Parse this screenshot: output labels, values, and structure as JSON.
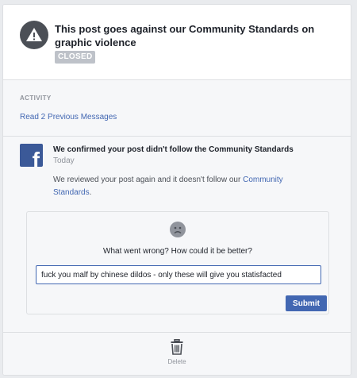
{
  "header": {
    "title": "This post goes against our Community Standards on graphic violence",
    "status_badge": "CLOSED",
    "icon": "warning-icon"
  },
  "activity": {
    "label": "ACTIVITY",
    "read_previous": "Read 2 Previous Messages"
  },
  "message": {
    "sender_icon": "facebook-logo",
    "title": "We confirmed your post didn't follow the Community Standards",
    "time": "Today",
    "body_prefix": "We reviewed your post again and it doesn't follow our ",
    "body_link": "Community Standards",
    "body_suffix": "."
  },
  "feedback": {
    "icon": "sad-face-icon",
    "question": "What went wrong? How could it be better?",
    "input_value": "fuck you malf by chinese dildos - only these will give you statisfacted",
    "submit_label": "Submit"
  },
  "footer": {
    "delete_icon": "trash-icon",
    "delete_label": "Delete"
  },
  "colors": {
    "link": "#4267b2",
    "badge": "#bec2c9",
    "icon_dark": "#4b4f56",
    "facebook_blue": "#3b5998"
  }
}
